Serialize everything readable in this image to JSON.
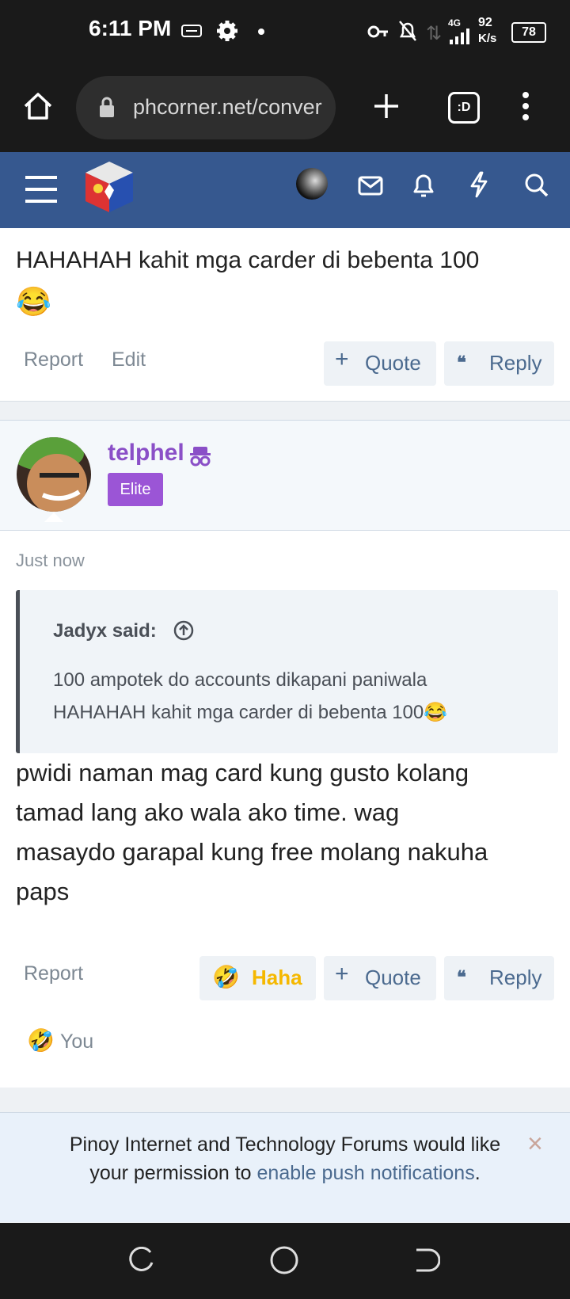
{
  "status_bar": {
    "time": "6:11 PM",
    "network": "4G",
    "speed_value": "92",
    "speed_unit": "K/s",
    "battery": "78"
  },
  "browser": {
    "url": "phcorner.net/conver",
    "tabs_label": ":D"
  },
  "post1": {
    "text_line": "HAHAHAH kahit mga carder di bebenta 100",
    "emoji": "😂",
    "report_label": "Report",
    "edit_label": "Edit",
    "quote_label": "Quote",
    "reply_label": "Reply"
  },
  "post2": {
    "username": "telphel",
    "badge": "Elite",
    "timestamp": "Just now",
    "quote_author": "Jadyx said:",
    "quote_text_1": "100 ampotek do accounts dikapani paniwala",
    "quote_text_2": "HAHAHAH kahit mga carder di bebenta 100😂",
    "body_lines": [
      "pwidi naman mag card kung gusto kolang",
      "tamad lang ako wala ako time. wag",
      "masaydo garapal kung free molang nakuha",
      "paps"
    ],
    "report_label": "Report",
    "haha_label": "Haha",
    "quote_label": "Quote",
    "reply_label": "Reply",
    "reaction_emoji": "🤣",
    "reaction_user": "You"
  },
  "notice": {
    "line1": "Pinoy Internet and Technology Forums would like",
    "line2_prefix": "your permission to ",
    "line2_link": "enable push notifications",
    "line2_suffix": ".",
    "close": "×"
  },
  "colors": {
    "header_blue": "#36588f",
    "username_purple": "#8a4fc7",
    "badge_purple": "#9b55d6",
    "haha_yellow": "#f5b800",
    "link_blue": "#4b6a8f"
  }
}
